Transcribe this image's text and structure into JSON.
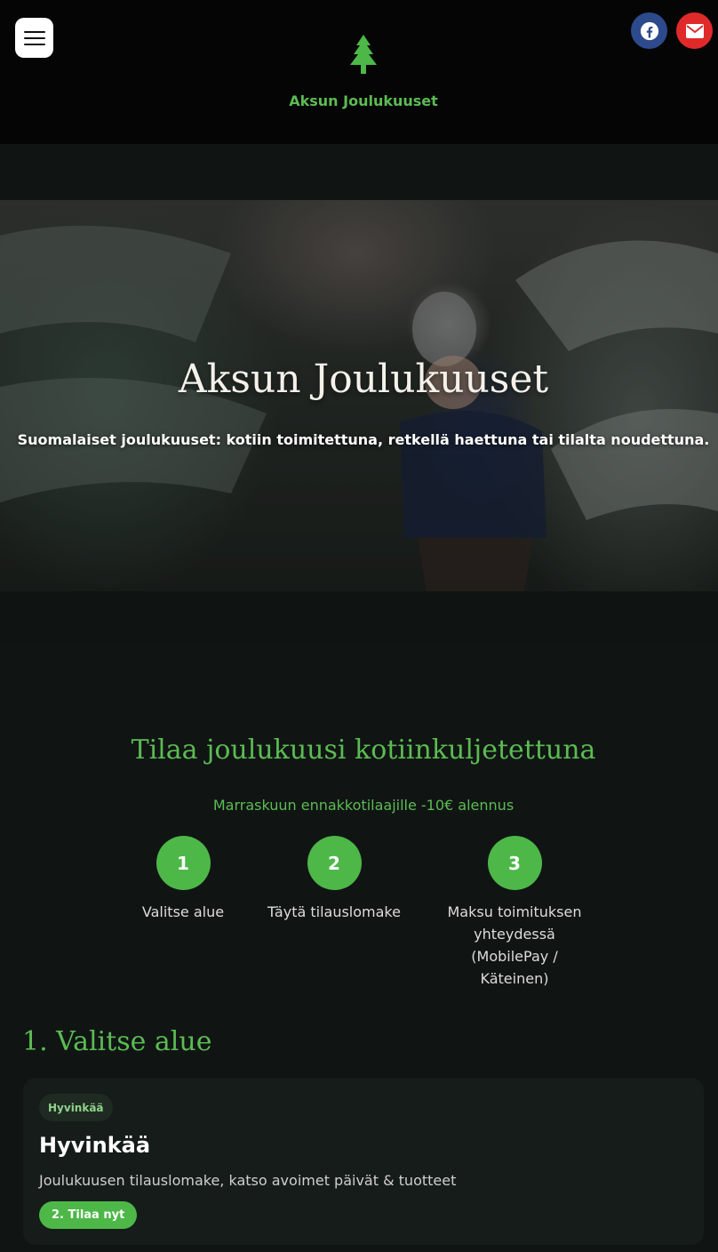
{
  "header": {
    "brand": "Aksun Joulukuuset",
    "menu_icon": "hamburger-menu-icon",
    "logo_icon": "pine-tree-icon",
    "social": [
      {
        "icon": "facebook-icon",
        "color": "#2d4a8c"
      },
      {
        "icon": "envelope-icon",
        "color": "#e02a2a"
      }
    ]
  },
  "hero": {
    "title": "Aksun Joulukuuset",
    "subtitle": "Suomalaiset joulukuuset: kotiin toimitettuna, retkellä haettuna tai tilalta noudettuna."
  },
  "order": {
    "title": "Tilaa joulukuusi kotiinkuljetettuna",
    "subtitle": "Marraskuun ennakkotilaajille -10€ alennus",
    "steps": [
      {
        "number": "1",
        "label": "Valitse alue"
      },
      {
        "number": "2",
        "label": "Täytä tilauslomake"
      },
      {
        "number": "3",
        "label": "Maksu toimituksen yhteydessä (MobilePay / Käteinen)"
      }
    ]
  },
  "areas": {
    "title": "1. Valitse alue",
    "cards": [
      {
        "badge": "Hyvinkää",
        "title": "Hyvinkää",
        "description": "Joulukuusen tilauslomake, katso avoimet päivät & tuotteet",
        "button": "2. Tilaa nyt"
      }
    ]
  },
  "colors": {
    "accent_green": "#5cbb52",
    "button_green": "#4db848",
    "facebook_blue": "#2d4a8c",
    "mail_red": "#e02a2a",
    "background": "#101514"
  }
}
